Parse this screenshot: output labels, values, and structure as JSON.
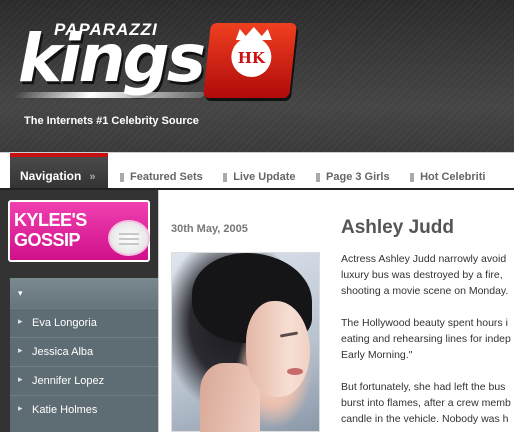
{
  "header": {
    "logo_top": "PAPARAZZI",
    "logo_main": "kings",
    "logo_badge": "HK",
    "tagline": "The Internets #1 Celebrity Source"
  },
  "nav": {
    "title": "Navigation",
    "arrow": "»",
    "items": [
      "Featured Sets",
      "Live Update",
      "Page 3 Girls",
      "Hot Celebriti"
    ]
  },
  "sidebar": {
    "gossip_line1": "KYLEE'S",
    "gossip_line2": "GOSSIP",
    "menu_head": "▾",
    "menu_items": [
      "Eva Longoria",
      "Jessica Alba",
      "Jennifer Lopez",
      "Katie Holmes"
    ]
  },
  "article": {
    "date": "30th May, 2005",
    "title": "Ashley Judd",
    "lines": [
      [
        "Actress Ashley Judd narrowly avoid",
        "luxury bus was destroyed by a fire,",
        "shooting a movie scene on Monday."
      ],
      [
        "The Hollywood beauty spent hours i",
        "eating and rehearsing lines for indep",
        "Early Morning.\""
      ],
      [
        "But fortunately, she had left the bus",
        "burst into flames, after a crew memb",
        "candle in the vehicle. Nobody was h"
      ]
    ]
  },
  "colors": {
    "brand_red": "#c81010",
    "gossip_pink": "#e020a0",
    "menu_slate": "#5e6c74"
  }
}
